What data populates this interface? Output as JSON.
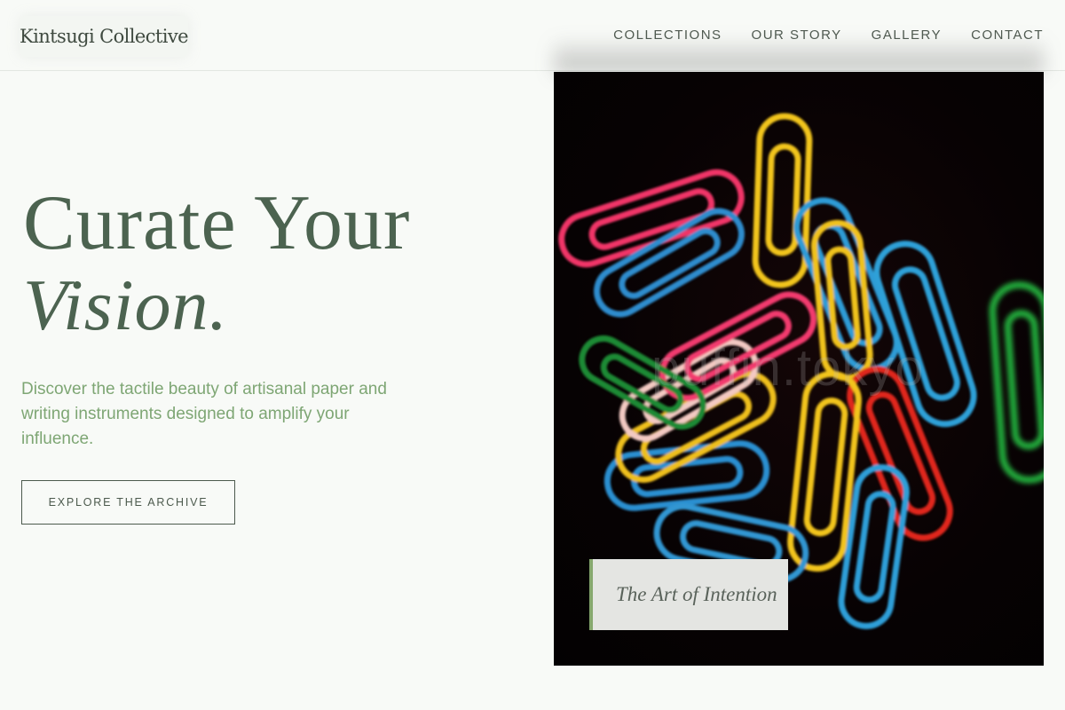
{
  "header": {
    "logo": "Kintsugi Collective",
    "nav": [
      "COLLECTIONS",
      "OUR STORY",
      "GALLERY",
      "CONTACT"
    ]
  },
  "hero": {
    "title_line1": "Curate Your",
    "title_line2": "Vision.",
    "subtitle": "Discover the tactile beauty of artisanal paper and writing instruments designed to amplify your influence.",
    "cta": "EXPLORE THE ARCHIVE"
  },
  "image": {
    "alt": "Colorful paperclips on a dark background",
    "watermark": "puffin.tokyo",
    "caption": "The Art of Intention"
  },
  "colors": {
    "background": "#f8faf7",
    "title": "#4c6350",
    "subtitle": "#7ea674",
    "caption_accent": "#86a86e"
  }
}
